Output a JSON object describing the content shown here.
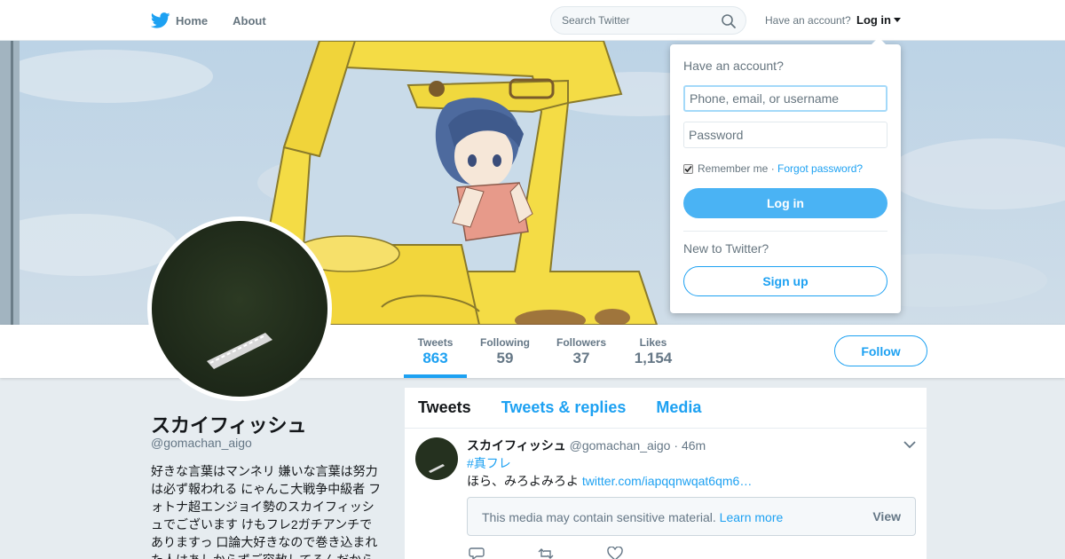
{
  "topbar": {
    "home_label": "Home",
    "about_label": "About",
    "search_placeholder": "Search Twitter",
    "have_account": "Have an account?",
    "login_label": "Log in"
  },
  "profile": {
    "name": "スカイフィッシュ",
    "handle": "@gomachan_aigo",
    "bio": "好きな言葉はマンネリ 嫌いな言葉は努力は必ず報われる にゃんこ大戦争中級者 フォトナ超エンジョイ勢のスカイフィッシュでございます けもフレ2ガチアンチでありますっ 口論大好きなので巻き込まれた人はあしからずご容赦してるんだからもしも…"
  },
  "stats": [
    {
      "label": "Tweets",
      "value": "863",
      "active": true
    },
    {
      "label": "Following",
      "value": "59",
      "active": false
    },
    {
      "label": "Followers",
      "value": "37",
      "active": false
    },
    {
      "label": "Likes",
      "value": "1,154",
      "active": false
    }
  ],
  "follow_label": "Follow",
  "timeline": {
    "tabs": [
      "Tweets",
      "Tweets & replies",
      "Media"
    ],
    "current_tab": "Tweets"
  },
  "tweet": {
    "name": "スカイフィッシュ",
    "handle": "@gomachan_aigo",
    "separator": "·",
    "time": "46m",
    "hashtag": "#真フレ",
    "text": "ほら、みろよみろよ ",
    "link": "twitter.com/iapqqnwqat6qm6…",
    "sensitive_msg": "This media may contain sensitive material.",
    "learn_more": "Learn more",
    "view_label": "View"
  },
  "login_dropdown": {
    "title": "Have an account?",
    "username_placeholder": "Phone, email, or username",
    "password_placeholder": "Password",
    "remember_label": "Remember me",
    "separator": " · ",
    "forgot_label": "Forgot password?",
    "remember_checked": true,
    "login_button": "Log in",
    "new_label": "New to Twitter?",
    "signup_button": "Sign up"
  },
  "colors": {
    "accent": "#1da1f2",
    "login_button": "#4ab3f4",
    "background": "#e6ecf0"
  },
  "icons": [
    "twitter-bird-icon",
    "home-icon",
    "search-icon",
    "caret-down-icon",
    "chevron-down-icon",
    "reply-icon",
    "retweet-icon",
    "like-icon",
    "checkbox-icon"
  ]
}
